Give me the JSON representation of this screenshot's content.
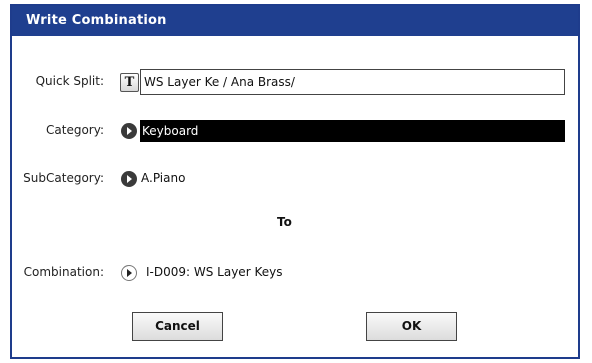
{
  "dialog": {
    "title": "Write Combination"
  },
  "quick_split": {
    "label": "Quick Split:",
    "text_button": "T",
    "value": "WS Layer Ke / Ana Brass/"
  },
  "category": {
    "label": "Category:",
    "value": "Keyboard"
  },
  "subcategory": {
    "label": "SubCategory:",
    "value": "A.Piano"
  },
  "to_label": "To",
  "combination": {
    "label": "Combination:",
    "value": "I-D009: WS Layer Keys"
  },
  "buttons": {
    "cancel": "Cancel",
    "ok": "OK"
  },
  "colors": {
    "title_bar": "#1f3f8f",
    "selected_field": "#000000"
  }
}
